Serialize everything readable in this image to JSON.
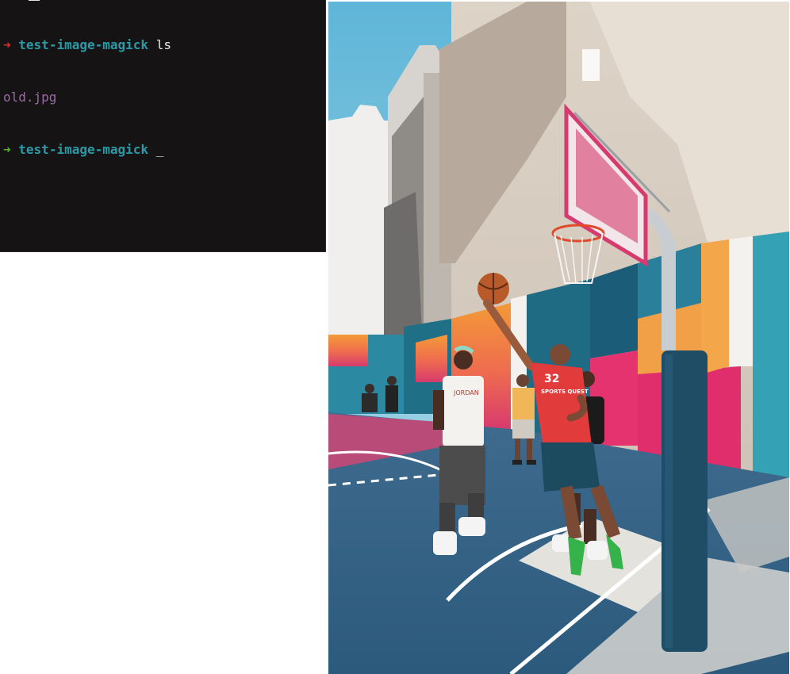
{
  "terminal": {
    "lines": [
      {
        "arrow": "➜",
        "arrow_color": "#e0302a",
        "dir": "test-image-magick",
        "command": "ls"
      },
      {
        "output": "old.jpg"
      },
      {
        "arrow": "➜",
        "arrow_color": "#57b52f",
        "dir": "test-image-magick",
        "cursor": "_"
      }
    ],
    "colors": {
      "background": "#151313",
      "directory": "#2b9aa6",
      "command": "#e8e8e8",
      "file": "#9b6aa6"
    }
  },
  "image": {
    "icon": "photo-basketball-court",
    "jersey_text": "SPORTS QUEST",
    "jersey_number": "32",
    "shirt_text": "JORDAN"
  }
}
